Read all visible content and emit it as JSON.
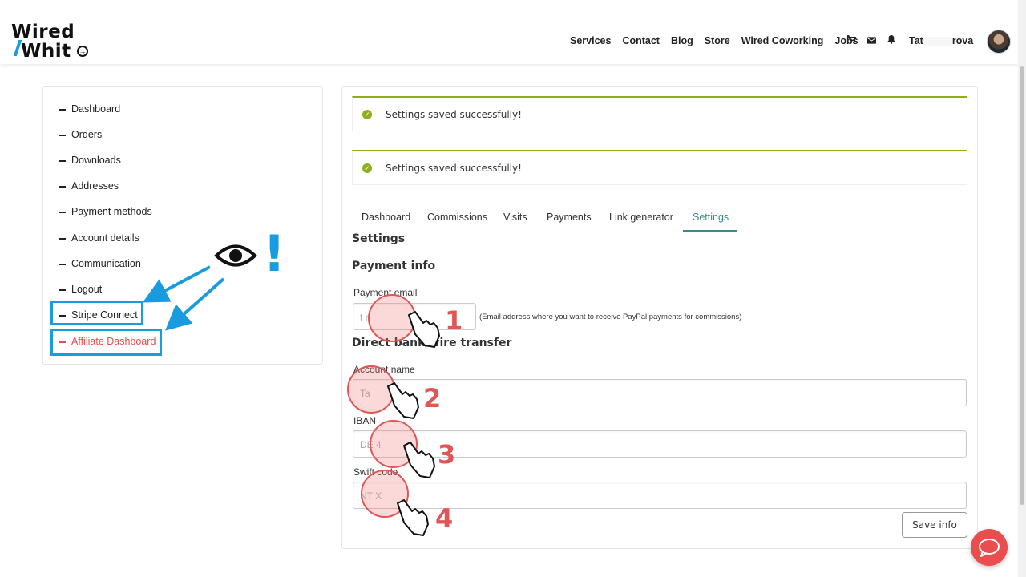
{
  "header": {
    "logo_line1": "Wired",
    "logo_line2": "Whit",
    "nav": [
      "Services",
      "Contact",
      "Blog",
      "Store",
      "Wired Coworking",
      "Jobs"
    ],
    "icons": [
      "cart-icon",
      "envelope-icon",
      "bell-icon"
    ],
    "user_name_start": "Tat",
    "user_name_end": "rova"
  },
  "sidebar": {
    "items": [
      {
        "label": "Dashboard"
      },
      {
        "label": "Orders"
      },
      {
        "label": "Downloads"
      },
      {
        "label": "Addresses"
      },
      {
        "label": "Payment methods"
      },
      {
        "label": "Account details"
      },
      {
        "label": "Communication"
      },
      {
        "label": "Logout"
      },
      {
        "label": "Stripe Connect"
      },
      {
        "label": "Affiliate Dashboard"
      }
    ],
    "active_item": "Affiliate Dashboard"
  },
  "notices": [
    {
      "text": "Settings saved successfully!"
    },
    {
      "text": "Settings saved successfully!"
    }
  ],
  "tabs": [
    {
      "label": "Dashboard"
    },
    {
      "label": "Commissions"
    },
    {
      "label": "Visits"
    },
    {
      "label": "Payments"
    },
    {
      "label": "Link generator"
    },
    {
      "label": "Settings"
    }
  ],
  "active_tab": "Settings",
  "form": {
    "heading": "Settings",
    "payment_heading": "Payment info",
    "payment_email_label": "Payment email",
    "payment_email_value": "t                         n",
    "payment_email_note": "(Email address where you want to receive PayPal payments for commissions)",
    "bank_heading": "Direct bank/wire transfer",
    "account_name_label": "Account name",
    "account_name_value": "Ta",
    "iban_label": "IBAN",
    "iban_value": "DE                              4",
    "swift_label": "Swift code",
    "swift_value": "NT              X",
    "save_label": "Save info"
  },
  "annotations": {
    "steps": [
      "1",
      "2",
      "3",
      "4"
    ],
    "exclamation": "!",
    "accent_blue": "#1a9be0",
    "accent_red": "#e05656"
  },
  "colors": {
    "success": "#8fae1b",
    "active_tab": "#3b8a8a",
    "active_sidebar": "#e84c4c",
    "chat_button": "#ea4d4d"
  }
}
